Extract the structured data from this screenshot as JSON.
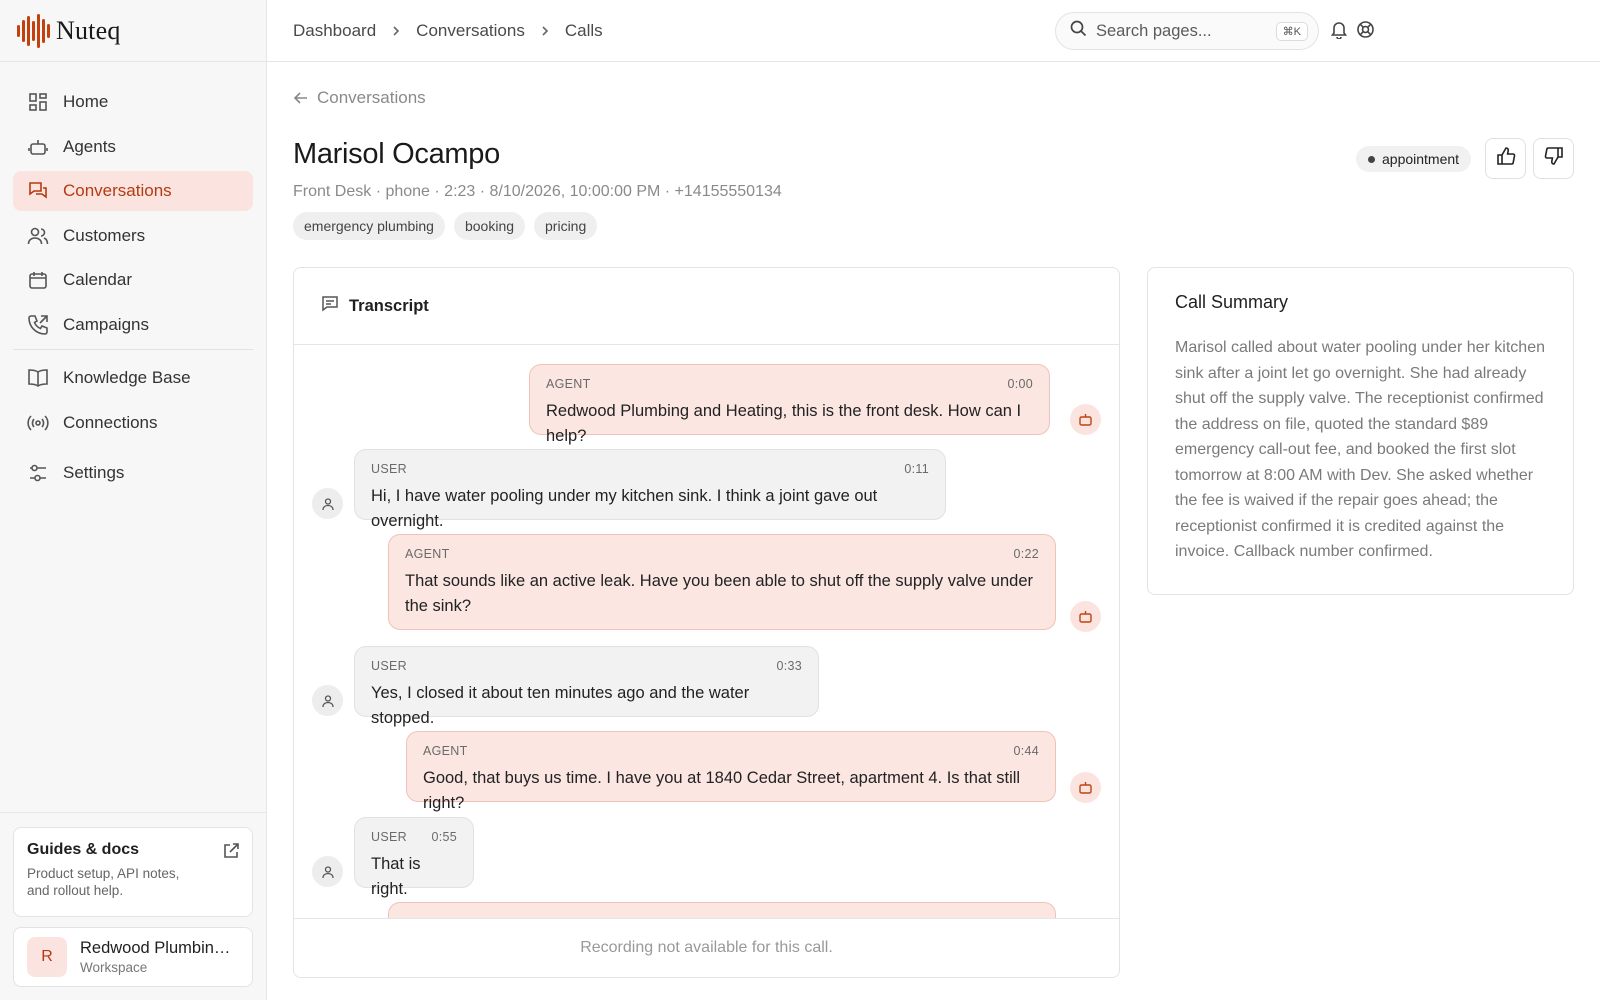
{
  "brand": {
    "name": "Nuteq"
  },
  "colors": {
    "accent": "#c2410c",
    "accent_bg": "#fbe4df",
    "agent_bubble": "#fbe6e2",
    "user_bubble": "#f2f2f2"
  },
  "sidebar": {
    "items": [
      {
        "label": "Home",
        "icon": "home-grid-icon",
        "active": false
      },
      {
        "label": "Agents",
        "icon": "robot-icon",
        "active": false
      },
      {
        "label": "Conversations",
        "icon": "chat-bubbles-icon",
        "active": true
      },
      {
        "label": "Customers",
        "icon": "users-icon",
        "active": false
      },
      {
        "label": "Calendar",
        "icon": "calendar-icon",
        "active": false
      },
      {
        "label": "Campaigns",
        "icon": "phone-outgoing-icon",
        "active": false
      },
      {
        "label": "Knowledge Base",
        "icon": "book-icon",
        "active": false
      },
      {
        "label": "Connections",
        "icon": "broadcast-icon",
        "active": false
      },
      {
        "label": "Settings",
        "icon": "sliders-icon",
        "active": false
      }
    ],
    "guides": {
      "title": "Guides & docs",
      "description": "Product setup, API notes, and rollout help."
    },
    "workspace": {
      "initial": "R",
      "name": "Redwood Plumbing and Heating",
      "subtitle": "Workspace"
    }
  },
  "topbar": {
    "breadcrumbs": [
      "Dashboard",
      "Conversations",
      "Calls"
    ],
    "search": {
      "placeholder": "Search pages...",
      "shortcut": "⌘K"
    }
  },
  "page": {
    "back_label": "Conversations",
    "title": "Marisol Ocampo",
    "meta": "Front Desk · phone · 2:23 · 8/10/2026, 10:00:00 PM · +14155550134",
    "tags": [
      "emergency plumbing",
      "booking",
      "pricing"
    ],
    "intent": "appointment"
  },
  "transcript": {
    "title": "Transcript",
    "messages": [
      {
        "role": "AGENT",
        "time": "0:00",
        "text": "Redwood Plumbing and Heating, this is the front desk. How can I help?"
      },
      {
        "role": "USER",
        "time": "0:11",
        "text": "Hi, I have water pooling under my kitchen sink. I think a joint gave out overnight."
      },
      {
        "role": "AGENT",
        "time": "0:22",
        "text": "That sounds like an active leak. Have you been able to shut off the supply valve under the sink?"
      },
      {
        "role": "USER",
        "time": "0:33",
        "text": "Yes, I closed it about ten minutes ago and the water stopped."
      },
      {
        "role": "AGENT",
        "time": "0:44",
        "text": "Good, that buys us time. I have you at 1840 Cedar Street, apartment 4. Is that still right?"
      },
      {
        "role": "USER",
        "time": "0:55",
        "text": "That is right."
      }
    ],
    "footer": "Recording not available for this call."
  },
  "summary": {
    "title": "Call Summary",
    "text": "Marisol called about water pooling under her kitchen sink after a joint let go overnight. She had already shut off the supply valve. The receptionist confirmed the address on file, quoted the standard $89 emergency call-out fee, and booked the first slot tomorrow at 8:00 AM with Dev. She asked whether the fee is waived if the repair goes ahead; the receptionist confirmed it is credited against the invoice. Callback number confirmed."
  }
}
